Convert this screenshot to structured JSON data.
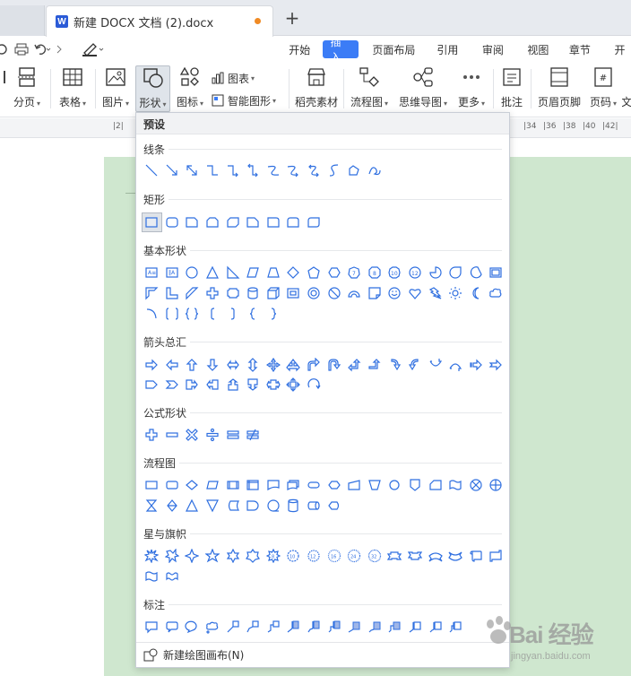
{
  "tabbar": {
    "doc_title": "新建 DOCX 文档 (2).docx",
    "add_tab": "+",
    "doc_icon_letter": "W"
  },
  "menu": {
    "items": [
      "开始",
      "插入",
      "页面布局",
      "引用",
      "审阅",
      "视图",
      "章节",
      "开"
    ],
    "active": "插入"
  },
  "ribbon": {
    "pagination": "分页",
    "table": "表格",
    "picture": "图片",
    "shape": "形状",
    "icon": "图标",
    "chart": "图表",
    "smart_graphic": "智能图形",
    "docer_material": "稻壳素材",
    "flowchart": "流程图",
    "mindmap": "思维导图",
    "more": "更多",
    "comment": "批注",
    "header_footer": "页眉页脚",
    "page_number": "页码",
    "cut_label": "文"
  },
  "ruler": {
    "ticks_left": [
      "2"
    ],
    "ticks_right": [
      "34",
      "36",
      "38",
      "40",
      "42"
    ]
  },
  "panel": {
    "header": "预设",
    "sections": [
      "线条",
      "矩形",
      "基本形状",
      "箭头总汇",
      "公式形状",
      "流程图",
      "星与旗帜",
      "标注"
    ],
    "footer": "新建绘图画布(N)"
  },
  "watermark": {
    "main": "Bai 经验",
    "sub": "jingyan.baidu.com"
  },
  "colors": {
    "accent": "#3b7cf6",
    "shape_stroke": "#2f6fe0",
    "page_bg": "#cfe7cf",
    "unsaved_dot": "#f08a24"
  }
}
